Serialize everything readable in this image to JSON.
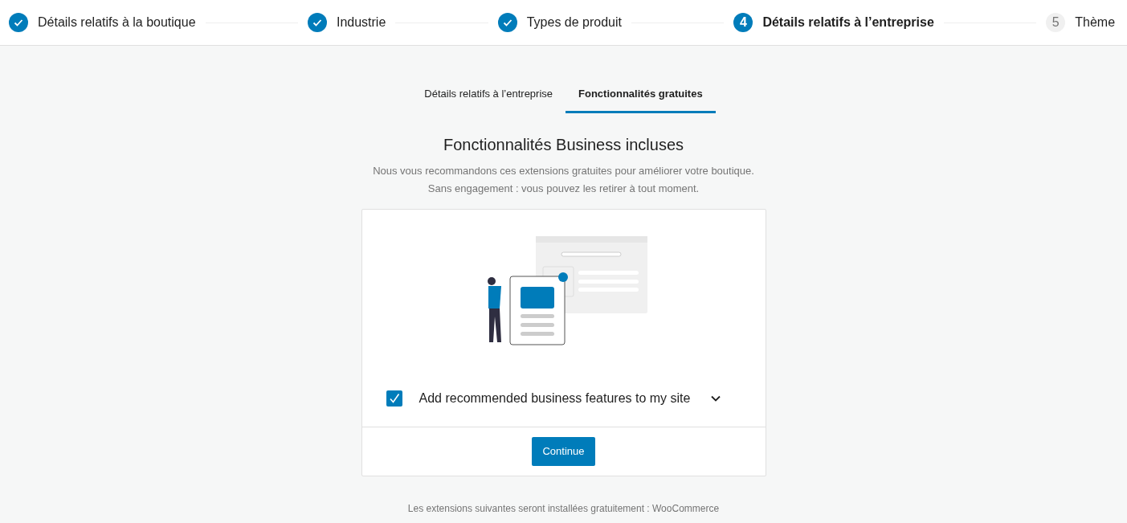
{
  "steps": [
    {
      "label": "Détails relatifs à la boutique",
      "completed": true
    },
    {
      "label": "Industrie",
      "completed": true
    },
    {
      "label": "Types de produit",
      "completed": true
    },
    {
      "number": "4",
      "label": "Détails relatifs à l’entreprise",
      "completed": false,
      "selected": true
    },
    {
      "number": "5",
      "label": "Thème",
      "completed": false,
      "selected": false
    }
  ],
  "tabs": [
    {
      "label": "Détails relatifs à l’entreprise",
      "selected": false
    },
    {
      "label": "Fonctionnalités gratuites",
      "selected": true
    }
  ],
  "heading": "Fonctionnalités Business incluses",
  "subtitle": [
    "Nous vous recommandons ces extensions gratuites pour améliorer votre boutique.",
    "Sans engagement : vous pouvez les retirer à tout moment."
  ],
  "card": {
    "option": {
      "label": "Add recommended business features to my site",
      "checked": true,
      "expanded": false
    },
    "button": "Continue"
  },
  "footnote": "Les extensions suivantes seront installées gratuitement : WooCommerce"
}
